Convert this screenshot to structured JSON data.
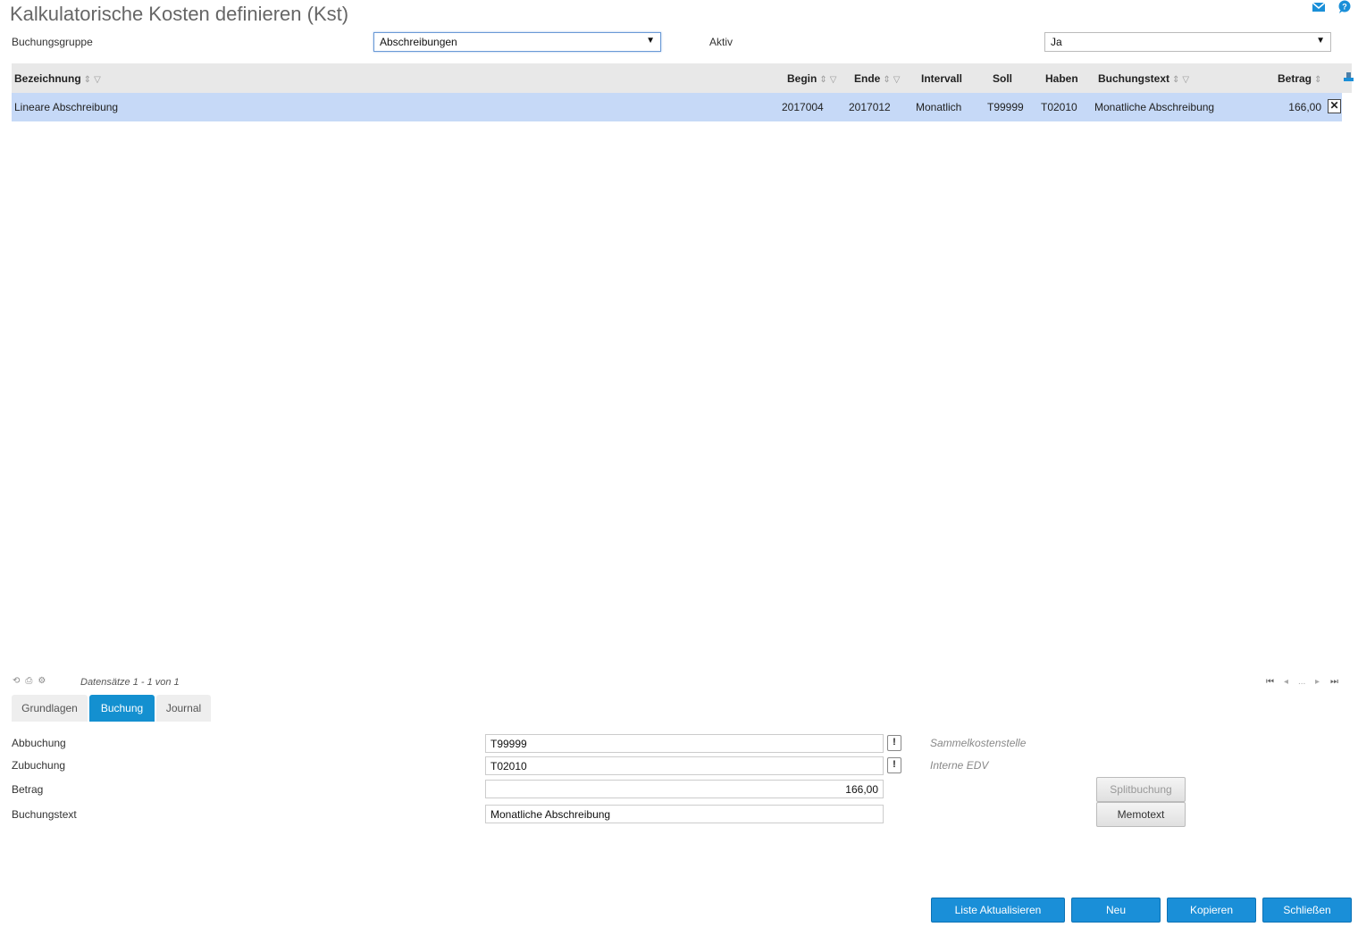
{
  "page": {
    "title": "Kalkulatorische Kosten definieren (Kst)"
  },
  "top_icons": [
    "mail-icon",
    "help-icon"
  ],
  "filters": {
    "buchungsgruppe_label": "Buchungsgruppe",
    "buchungsgruppe_value": "Abschreibungen",
    "aktiv_label": "Aktiv",
    "aktiv_value": "Ja"
  },
  "grid": {
    "columns": {
      "bezeichnung": "Bezeichnung",
      "begin": "Begin",
      "ende": "Ende",
      "intervall": "Intervall",
      "soll": "Soll",
      "haben": "Haben",
      "buchungstext": "Buchungstext",
      "betrag": "Betrag"
    },
    "rows": [
      {
        "bezeichnung": "Lineare Abschreibung",
        "begin": "2017004",
        "ende": "2017012",
        "intervall": "Monatlich",
        "soll": "T99999",
        "haben": "T02010",
        "buchungstext": "Monatliche Abschreibung",
        "betrag": "166,00",
        "delete": "✕"
      }
    ]
  },
  "footer": {
    "record_info": "Datensätze 1 - 1 von 1",
    "pager_dots": "..."
  },
  "tabs": [
    {
      "label": "Grundlagen"
    },
    {
      "label": "Buchung"
    },
    {
      "label": "Journal"
    }
  ],
  "active_tab": "Buchung",
  "form": {
    "abbuchung_label": "Abbuchung",
    "abbuchung_value": "T99999",
    "abbuchung_hint": "Sammelkostenstelle",
    "zubuchung_label": "Zubuchung",
    "zubuchung_value": "T02010",
    "zubuchung_hint": "Interne EDV",
    "betrag_label": "Betrag",
    "betrag_value": "166,00",
    "buchungstext_label": "Buchungstext",
    "buchungstext_value": "Monatliche Abschreibung",
    "excl": "!",
    "splitbuchung_label": "Splitbuchung",
    "memotext_label": "Memotext"
  },
  "actions": {
    "liste_aktualisieren": "Liste Aktualisieren",
    "neu": "Neu",
    "kopieren": "Kopieren",
    "schliessen": "Schließen"
  },
  "colors": {
    "accent": "#1a8fd8",
    "selected_row": "#c6d9f7",
    "header_bg": "#e8e8e8"
  }
}
